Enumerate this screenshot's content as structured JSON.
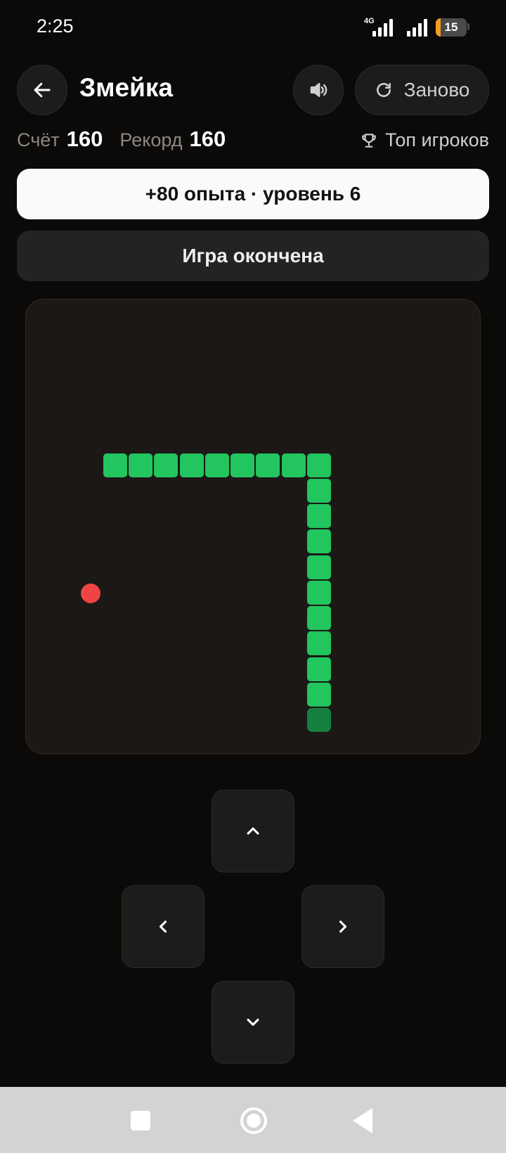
{
  "status_bar": {
    "time": "2:25",
    "network": "4G",
    "battery_level": "15",
    "battery_color": "#f0a020"
  },
  "header": {
    "title": "Змейка",
    "back_icon": "arrow-left-icon",
    "sound_icon": "speaker-icon",
    "restart_icon": "refresh-icon",
    "restart_label": "Заново"
  },
  "scores": {
    "score_label": "Счёт",
    "score_value": "160",
    "record_label": "Рекорд",
    "record_value": "160",
    "top_icon": "trophy-icon",
    "top_label": "Топ игроков"
  },
  "xp_banner": {
    "text": "+80 опыта · уровень 6"
  },
  "status_banner": {
    "text": "Игра окончена"
  },
  "board": {
    "grid_size": 18,
    "snake_color": "#22c55e",
    "tail_color": "#16803e",
    "food_color": "#ef4444",
    "snake": [
      [
        3,
        6
      ],
      [
        4,
        6
      ],
      [
        5,
        6
      ],
      [
        6,
        6
      ],
      [
        7,
        6
      ],
      [
        8,
        6
      ],
      [
        9,
        6
      ],
      [
        10,
        6
      ],
      [
        11,
        6
      ],
      [
        11,
        7
      ],
      [
        11,
        8
      ],
      [
        11,
        9
      ],
      [
        11,
        10
      ],
      [
        11,
        11
      ],
      [
        11,
        12
      ],
      [
        11,
        13
      ],
      [
        11,
        14
      ],
      [
        11,
        15
      ],
      [
        11,
        16
      ]
    ],
    "tail_cell": [
      11,
      16
    ],
    "food": [
      2,
      11
    ]
  },
  "controls": {
    "up_icon": "chevron-up-icon",
    "left_icon": "chevron-left-icon",
    "right_icon": "chevron-right-icon",
    "down_icon": "chevron-down-icon"
  },
  "nav_bar": {
    "recents_icon": "square-icon",
    "home_icon": "circle-icon",
    "back_icon": "triangle-back-icon"
  }
}
